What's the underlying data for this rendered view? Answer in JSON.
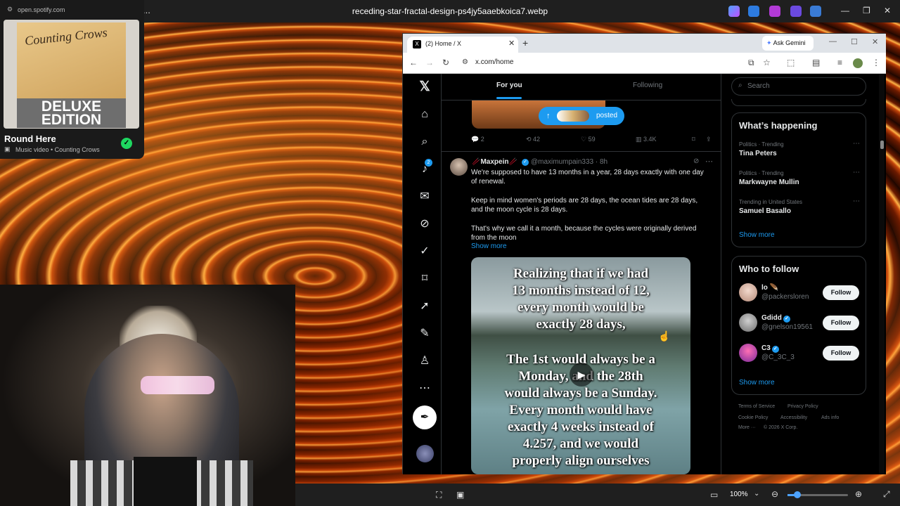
{
  "viewer": {
    "title": "receding-star-fractal-design-ps4jy5aaebkoica7.webp",
    "zoom": "100%",
    "menu": "..."
  },
  "spotify": {
    "url": "open.spotify.com",
    "album_band": "Counting Crows",
    "album_badge_line1": "DELUXE",
    "album_badge_line2": "EDITION",
    "track_title": "Round Here",
    "track_subtitle": "Music video • Counting Crows"
  },
  "browser": {
    "tab_title": "(2) Home / X",
    "url": "x.com/home",
    "ask_gemini": "Ask Gemini"
  },
  "feed": {
    "tabs": [
      "For you",
      "Following"
    ],
    "posted_label": "posted",
    "prev_stats": {
      "replies": "2",
      "reposts": "42",
      "likes": "59",
      "views": "3.4K"
    },
    "post": {
      "name": "Maxpein",
      "handle": "@maximumpain333 · 8h",
      "text1": "We're supposed to have 13 months in a year, 28 days exactly with one day of renewal.",
      "text2": "Keep in mind women's periods are 28 days, the ocean tides are 28 days, and the moon cycle is 28 days.",
      "text3": "That's why we call it a month, because the cycles were originally derived from the moon",
      "show_more": "Show more",
      "video_lines": [
        "Realizing that if we had",
        "13 months instead of 12,",
        "every month would be",
        "exactly 28 days,",
        "The 1st would always be a",
        "Monday, and the 28th",
        "would always be a Sunday.",
        "Every month would have",
        "exactly 4 weeks instead of",
        "4.257, and we would",
        "properly align ourselves"
      ]
    }
  },
  "sidebar": {
    "search_placeholder": "Search",
    "happening_title": "What’s happening",
    "trends": [
      {
        "category": "Politics · Trending",
        "name": "Tina Peters"
      },
      {
        "category": "Politics · Trending",
        "name": "Markwayne Mullin"
      },
      {
        "category": "Trending in United States",
        "name": "Samuel Basallo"
      }
    ],
    "show_more": "Show more",
    "wtf_title": "Who to follow",
    "wtf": [
      {
        "name": "lo",
        "handle": "@packersloren",
        "button": "Follow"
      },
      {
        "name": "Gdidd",
        "handle": "@gnelson19561",
        "button": "Follow"
      },
      {
        "name": "C3",
        "handle": "@C_3C_3",
        "button": "Follow"
      }
    ],
    "footer": [
      "Terms of Service",
      "Privacy Policy",
      "Cookie Policy",
      "Accessibility",
      "Ads info",
      "More ···",
      "© 2026 X Corp."
    ]
  },
  "colors": {
    "x_blue": "#1d9bf0",
    "spotify_green": "#1ed760"
  }
}
